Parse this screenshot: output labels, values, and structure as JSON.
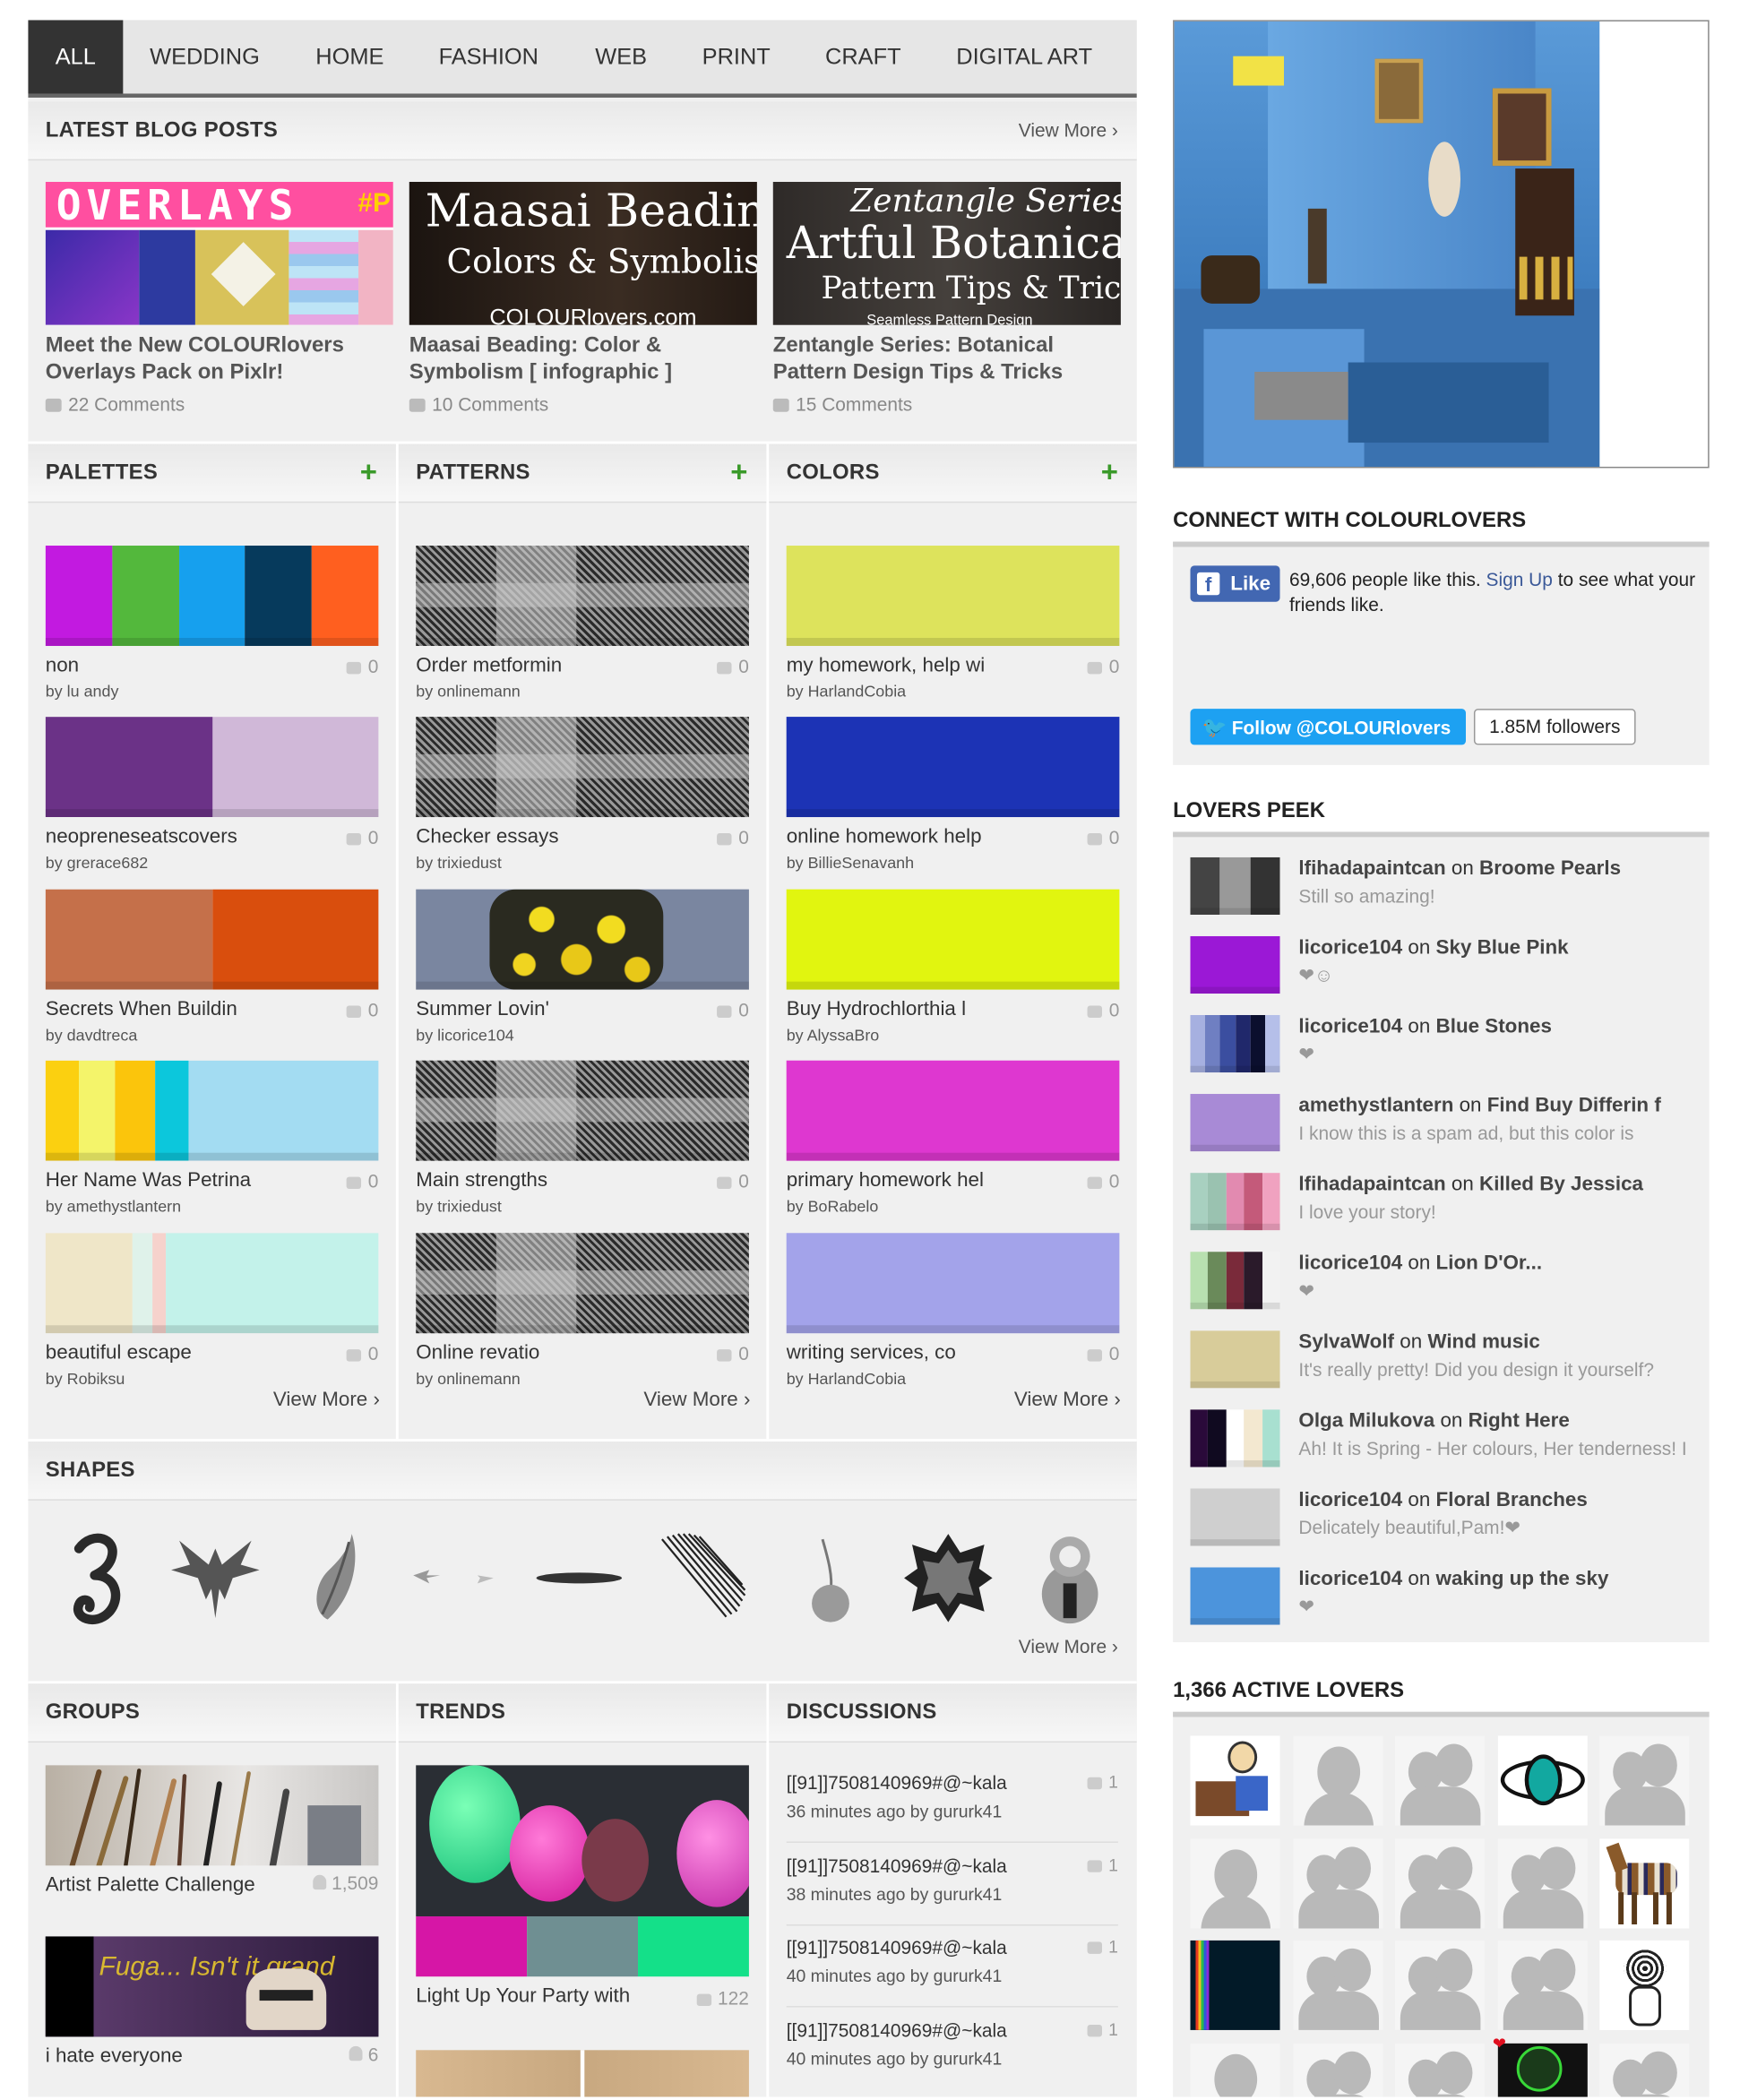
{
  "nav": {
    "tabs": [
      "ALL",
      "WEDDING",
      "HOME",
      "FASHION",
      "WEB",
      "PRINT",
      "CRAFT",
      "DIGITAL ART"
    ]
  },
  "blog": {
    "title": "LATEST BLOG POSTS",
    "view_more": "View More ›",
    "posts": [
      {
        "image_text": "OVERLAYS",
        "image_tag": "#P",
        "title": "Meet the New COLOURlovers Overlays Pack on Pixlr!",
        "comments": "22 Comments"
      },
      {
        "image_line1": "Maasai Beading",
        "image_line2": "Colors & Symbolism",
        "image_line3": "COLOURlovers.com",
        "title": "Maasai Beading: Color & Symbolism [ infographic ]",
        "comments": "10 Comments"
      },
      {
        "image_line1": "Zentangle Series",
        "image_line2": "Artful Botanical",
        "image_line3": "Pattern Tips & Tricks",
        "image_line4": "Seamless Pattern Design",
        "title": "Zentangle Series: Botanical Pattern Design Tips & Tricks",
        "comments": "15 Comments"
      }
    ]
  },
  "palettes": {
    "title": "PALETTES",
    "plus": "+",
    "view_more": "View More ›",
    "items": [
      {
        "name": "non",
        "by": "by lu andy",
        "count": "0",
        "colors": [
          "#c21ae0",
          "#53b83c",
          "#16a0ee",
          "#063a5c",
          "#ff5f1f"
        ],
        "widths": [
          20,
          20,
          20,
          20,
          20
        ]
      },
      {
        "name": "neopreneseatscovers",
        "by": "by grerace682",
        "count": "0",
        "colors": [
          "#6b3287",
          "#d0b8d8"
        ],
        "widths": [
          50,
          50
        ]
      },
      {
        "name": "Secrets When Buildin",
        "by": "by davdtreca",
        "count": "0",
        "colors": [
          "#c5704a",
          "#d94e0d"
        ],
        "widths": [
          50,
          50
        ]
      },
      {
        "name": "Her Name Was Petrina",
        "by": "by amethystlantern",
        "count": "0",
        "colors": [
          "#fbd010",
          "#f4f46a",
          "#fbc50c",
          "#0cc7dc",
          "#a3dcf2"
        ],
        "widths": [
          10,
          11,
          12,
          10,
          57
        ]
      },
      {
        "name": "beautiful escape",
        "by": "by Robiksu",
        "count": "0",
        "colors": [
          "#efe6c8",
          "#dff2ea",
          "#f6d2cc",
          "#c3f2ea"
        ],
        "widths": [
          26,
          6,
          4,
          64
        ]
      }
    ]
  },
  "patterns": {
    "title": "PATTERNS",
    "plus": "+",
    "view_more": "View More ›",
    "items": [
      {
        "name": "Order metformin",
        "by": "by onlinemann",
        "count": "0"
      },
      {
        "name": "Checker essays",
        "by": "by trixiedust",
        "count": "0"
      },
      {
        "name": "Summer Lovin'",
        "by": "by licorice104",
        "count": "0"
      },
      {
        "name": "Main strengths",
        "by": "by trixiedust",
        "count": "0"
      },
      {
        "name": "Online revatio",
        "by": "by onlinemann",
        "count": "0"
      }
    ]
  },
  "colors": {
    "title": "COLORS",
    "plus": "+",
    "view_more": "View More ›",
    "items": [
      {
        "name": "my homework, help wi",
        "by": "by HarlandCobia",
        "count": "0",
        "color": "#dde35c"
      },
      {
        "name": "online homework help",
        "by": "by BillieSenavanh",
        "count": "0",
        "color": "#1c33b5"
      },
      {
        "name": "Buy Hydrochlorthia l",
        "by": "by AlyssaBro",
        "count": "0",
        "color": "#e1f50f"
      },
      {
        "name": "primary homework hel",
        "by": "by BoRabelo",
        "count": "0",
        "color": "#de37d0"
      },
      {
        "name": "writing services, co",
        "by": "by HarlandCobia",
        "count": "0",
        "color": "#a3a3ea"
      }
    ]
  },
  "shapes": {
    "title": "SHAPES",
    "view_more": "View More ›"
  },
  "groups": {
    "title": "GROUPS",
    "items": [
      {
        "name": "Artist Palette Challenge",
        "count": "1,509"
      },
      {
        "name": "i hate everyone",
        "count": "6",
        "image_text": "Fuga... Isn't it grand"
      }
    ]
  },
  "trends": {
    "title": "TRENDS",
    "items": [
      {
        "name": "Light Up Your Party with",
        "count": "122",
        "colors": [
          "#d616a6",
          "#6f8f92",
          "#14e089"
        ]
      }
    ]
  },
  "discussions": {
    "title": "DISCUSSIONS",
    "items": [
      {
        "title": "[[91]]7508140969#@~kala",
        "meta": "36 minutes ago by gururk41",
        "count": "1"
      },
      {
        "title": "[[91]]7508140969#@~kala",
        "meta": "38 minutes ago by gururk41",
        "count": "1"
      },
      {
        "title": "[[91]]7508140969#@~kala",
        "meta": "40 minutes ago by gururk41",
        "count": "1"
      },
      {
        "title": "[[91]]7508140969#@~kala",
        "meta": "40 minutes ago by gururk41",
        "count": "1"
      }
    ]
  },
  "connect": {
    "title": "CONNECT WITH COLOURLOVERS",
    "like": "Like",
    "like_text_a": "69,606 people like this.",
    "sign_up": "Sign Up",
    "like_text_b": "to see what your friends like.",
    "follow": "Follow @COLOURlovers",
    "followers": "1.85M followers"
  },
  "peek": {
    "title": "LOVERS PEEK",
    "items": [
      {
        "user": "lfihadapaintcan",
        "on": "on",
        "target": "Broome Pearls",
        "comment": "Still so amazing!",
        "colors": [
          "#444",
          "#999",
          "#333"
        ]
      },
      {
        "user": "licorice104",
        "on": "on",
        "target": "Sky Blue Pink",
        "comment": "❤☺",
        "colors": [
          "#9b18d6"
        ]
      },
      {
        "user": "licorice104",
        "on": "on",
        "target": "Blue Stones",
        "comment": "❤",
        "colors": [
          "#a6b0e0",
          "#6f7fc2",
          "#3b4ea0",
          "#20286b",
          "#0b0f2e",
          "#b5bfe9"
        ]
      },
      {
        "user": "amethystlantern",
        "on": "on",
        "target": "Find Buy Differin f",
        "comment": "I know this is a spam ad, but this color is",
        "colors": [
          "#a88ad6"
        ]
      },
      {
        "user": "lfihadapaintcan",
        "on": "on",
        "target": "Killed By Jessica",
        "comment": "I love your story!",
        "colors": [
          "#a8d0c0",
          "#9ac2b0",
          "#e28ab0",
          "#c45a7a",
          "#f0a2c0"
        ]
      },
      {
        "user": "licorice104",
        "on": "on",
        "target": "Lion D'Or...",
        "comment": "❤",
        "colors": [
          "#b8e0b0",
          "#6a8a5a",
          "#7a2a3a",
          "#2a1a2a",
          "#f2f2f2"
        ]
      },
      {
        "user": "SylvaWolf",
        "on": "on",
        "target": "Wind music",
        "comment": "It's really pretty! Did you design it yourself?",
        "colors": [
          "#d8cc9a"
        ]
      },
      {
        "user": "Olga Milukova",
        "on": "on",
        "target": "Right Here",
        "comment": "Ah! It is Spring - Her colours, Her tenderness! I",
        "colors": [
          "#2a0a3a",
          "#100a20",
          "#ffffff",
          "#f3e8d0",
          "#a8e0d0"
        ]
      },
      {
        "user": "licorice104",
        "on": "on",
        "target": "Floral Branches",
        "comment": "Delicately beautiful,Pam!❤",
        "colors": [
          "#cfcfcf"
        ]
      },
      {
        "user": "licorice104",
        "on": "on",
        "target": "waking up the sky",
        "comment": "❤",
        "colors": [
          "#4c94dc"
        ]
      }
    ]
  },
  "active": {
    "title": "1,366 ACTIVE LOVERS"
  }
}
